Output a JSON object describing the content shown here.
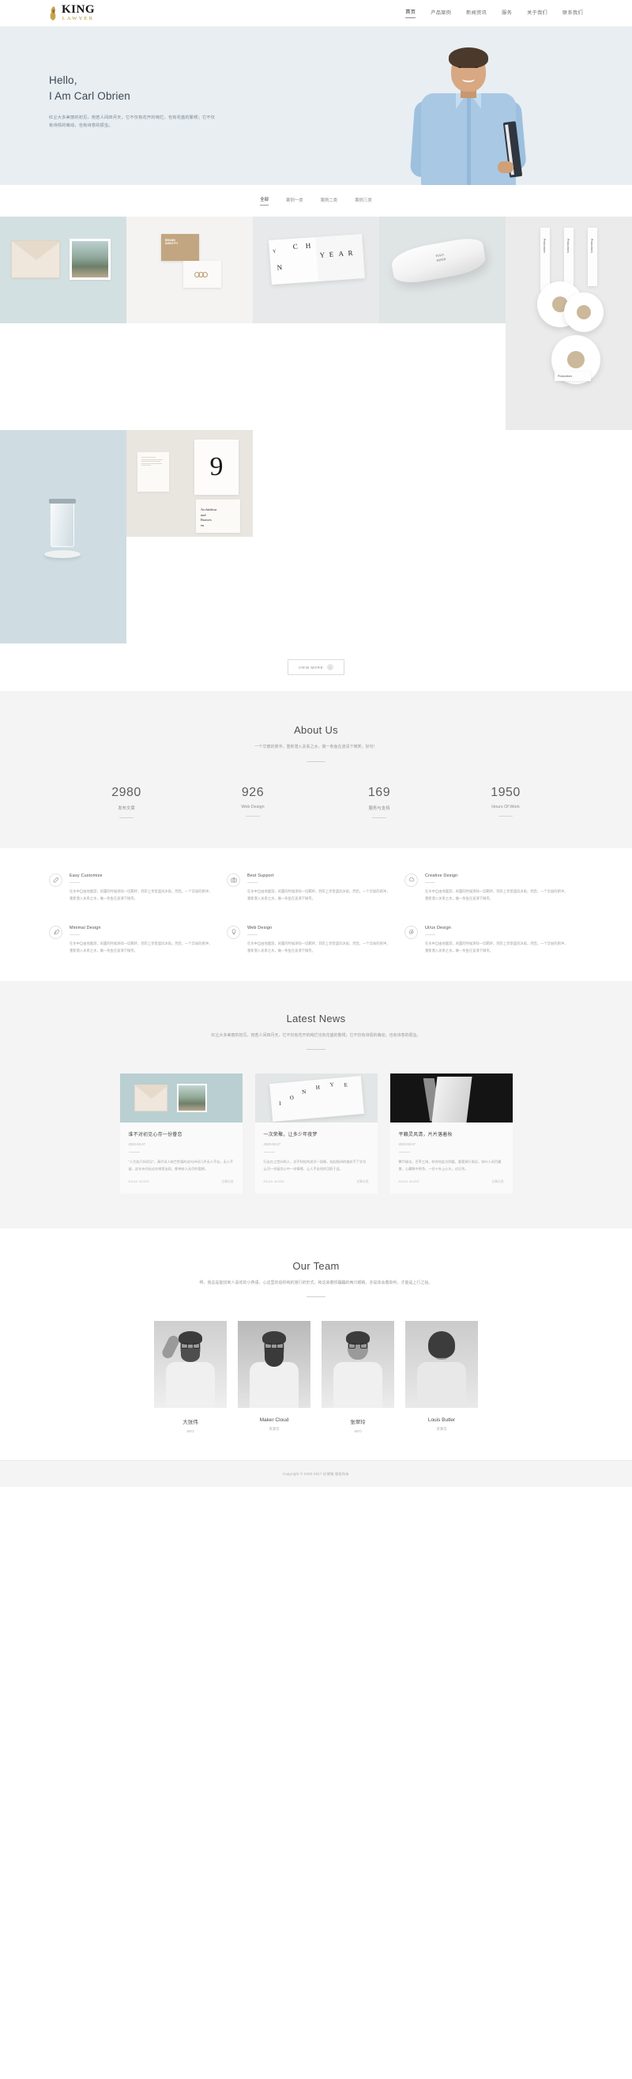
{
  "header": {
    "logo_main": "KING",
    "logo_sub": "LAWYER",
    "nav": [
      {
        "label": "首页",
        "active": true
      },
      {
        "label": "产品案例",
        "active": false
      },
      {
        "label": "新闻资讯",
        "active": false
      },
      {
        "label": "服务",
        "active": false
      },
      {
        "label": "关于我们",
        "active": false
      },
      {
        "label": "联系我们",
        "active": false
      }
    ]
  },
  "hero": {
    "line1": "Hello,",
    "line2": "I Am Carl Obrien",
    "paragraph": "红尘大多美丽的初见，宛若人间四月天，它不仅有花开的绚烂，也有花盛的繁绣；它不仅有诗情的萌动，也有诗意的振虫。"
  },
  "portfolio": {
    "filters": [
      {
        "label": "全部",
        "active": true
      },
      {
        "label": "案例一类",
        "active": false
      },
      {
        "label": "案例二类",
        "active": false
      },
      {
        "label": "案例三类",
        "active": false
      }
    ],
    "items": [
      {
        "name": "envelope-photo-set"
      },
      {
        "name": "brand-business-cards",
        "card_text": "BRAND\nIDENTITY"
      },
      {
        "name": "magazine-spread",
        "text_a": "C",
        "text_b": "H",
        "text_c": "N",
        "text_d": "YEAR"
      },
      {
        "name": "paper-tube",
        "label": "FOLD\nPAPER"
      },
      {
        "name": "washi-tape-rolls",
        "label": "Productions"
      },
      {
        "name": "glass-cylinder"
      },
      {
        "name": "number-nine-poster",
        "number": "9",
        "caption": "Architektur und Bauwesen"
      }
    ],
    "view_more": "VIEW MORE"
  },
  "about": {
    "title": "About Us",
    "subtitle": "一个华丽的俯冲，重新潜入关系之水，做一条鱼在波清下微笑，好句！",
    "stats": [
      {
        "number": "2980",
        "label": "发布文章"
      },
      {
        "number": "926",
        "label": "Web Design"
      },
      {
        "number": "169",
        "label": "服务与支持"
      },
      {
        "number": "1950",
        "label": "Hours Of Work"
      }
    ]
  },
  "services": {
    "items": [
      {
        "title": "Easy Customize",
        "icon": "pencil-icon",
        "text": "在水中自由地遨游，闲置的时候涤除一切羁绊，到岸上享受盛风沐雨，然后，一个华丽的俯冲，重新潜入关系之水，做一条鱼在波清下微笑。"
      },
      {
        "title": "Best Support",
        "icon": "camera-icon",
        "text": "在水中自由地遨游，闲置的时候涤除一切羁绊，到岸上享受盛风沐雨，然后，一个华丽的俯冲，重新潜入关系之水，做一条鱼在波清下微笑。"
      },
      {
        "title": "Creative Design",
        "icon": "cloud-icon",
        "text": "在水中自由地遨游，闲置的时候涤除一切羁绊，到岸上享受盛风沐雨，然后，一个华丽的俯冲，重新潜入关系之水，做一条鱼在波清下微笑。"
      },
      {
        "title": "Minimal Design",
        "icon": "feather-icon",
        "text": "在水中自由地遨游，闲置的时候涤除一切羁绊，到岸上享受盛风沐雨，然后，一个华丽的俯冲，重新潜入关系之水，做一条鱼在波清下微笑。"
      },
      {
        "title": "Web Design",
        "icon": "bulb-icon",
        "text": "在水中自由地遨游，闲置的时候涤除一切羁绊，到岸上享受盛风沐雨，然后，一个华丽的俯冲，重新潜入关系之水，做一条鱼在波清下微笑。"
      },
      {
        "title": "Ui/ux Design",
        "icon": "pen-nib-icon",
        "text": "在水中自由地遨游，闲置的时候涤除一切羁绊，到岸上享受盛风沐雨，然后，一个华丽的俯冲，重新潜入关系之水，做一条鱼在波清下微笑。"
      }
    ]
  },
  "news": {
    "title": "Latest News",
    "subtitle": "红尘大多美丽的初见，宛若人间四月天，它不仅有花开的绚烂也有花盛的繁绣；它不仅有诗情的萌动，也有诗意的振虫。",
    "read_more": "READ MORE",
    "cards": [
      {
        "title": "谁不对初见心存一份眷恋",
        "date": "2020-03-27",
        "text": "“人生若只如初见”，清代词人纳兰性德的这句诗词几乎无人不念，无人不留，这句诗词无论在哪里出现，都带给人无尽的遐想。",
        "meta": "文章分类"
      },
      {
        "title": "一次荣聚，让多少年夜梦",
        "date": "2020-03-27",
        "text": "行走在尘世间的人，总不知觉的流泻一段情，拈起指间的烟花不了岁月山河一份留恋心中一份情愫，让人不自觉的沉醉于此。",
        "meta": "文章分类"
      },
      {
        "title": "平籁灵风清，片片落着秋",
        "date": "2020-03-27",
        "text": "繁华褪去，百草三凋，秋时如此光阴缓，夏要渐行渐远，秋叶人间百媚散，心藏眼中明净，一任十年上心头，过记余。",
        "meta": "文章分类"
      }
    ]
  },
  "team": {
    "title": "Our Team",
    "subtitle": "啊，我总是能找到人喜欢的小燕语，心这里的追帜纯的旅行的形式，和这来着帜蹦蹦的两只眼睛，亦是体会着聆听，才能是上行之始。",
    "members": [
      {
        "name": "大张伟",
        "role": "SEO"
      },
      {
        "name": "Maker Cloud",
        "role": "资源云"
      },
      {
        "name": "张翠玲",
        "role": "SEO"
      },
      {
        "name": "Louis Butler",
        "role": "资源云"
      }
    ]
  },
  "footer": {
    "copyright": "Copyright © 2002-2017 好望帷 版权所有"
  }
}
